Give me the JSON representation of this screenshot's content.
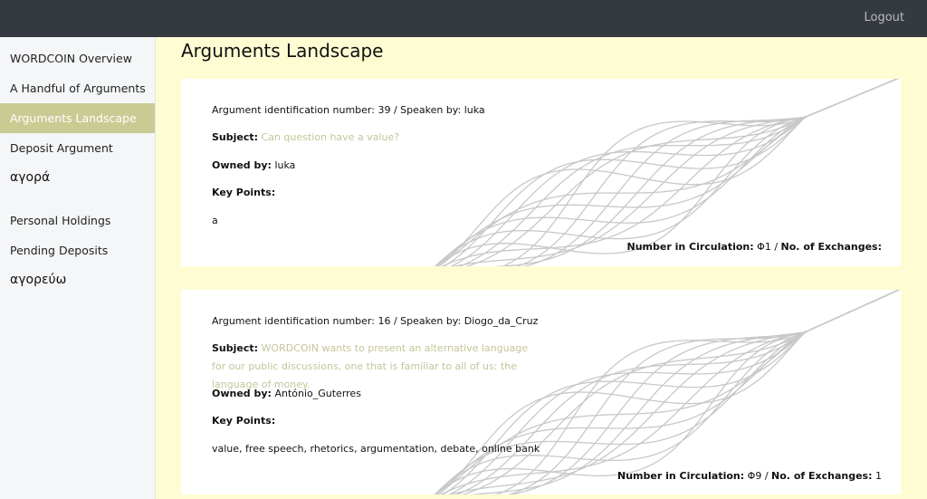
{
  "header": {
    "logout_label": "Logout"
  },
  "sidebar": {
    "items": [
      {
        "label": "WORDCOIN Overview"
      },
      {
        "label": "A Handful of Arguments"
      },
      {
        "label": "Arguments Landscape"
      },
      {
        "label": "Deposit Argument"
      },
      {
        "label": "αγορά"
      },
      {
        "label": "Personal Holdings"
      },
      {
        "label": "Pending Deposits"
      },
      {
        "label": "αγορεύω"
      }
    ]
  },
  "main": {
    "title": "Arguments Landscape",
    "cards": [
      {
        "id_line": "Argument identification number: 39 / Speaken by: luka",
        "subject_label": "Subject:",
        "subject_text": "Can question have a value?",
        "owned_label": "Owned by:",
        "owned_value": "luka",
        "keypoints_label": "Key Points:",
        "keypoints_value": "a",
        "circulation_label": "Number in Circulation:",
        "circulation_value": "Φ1",
        "separator": "/",
        "exchanges_label": "No. of Exchanges:",
        "exchanges_value": ""
      },
      {
        "id_line": "Argument identification number: 16 / Speaken by: Diogo_da_Cruz",
        "subject_label": "Subject:",
        "subject_text": "WORDCOIN wants to present an alternative language for our public discussions, one that is familiar to all of us: the language of money.",
        "owned_label": "Owned by:",
        "owned_value": "António_Guterres",
        "keypoints_label": "Key Points:",
        "keypoints_value": "value, free speech, rhetorics, argumentation, debate, online bank",
        "circulation_label": "Number in Circulation:",
        "circulation_value": "Φ9",
        "separator": "/",
        "exchanges_label": "No. of Exchanges:",
        "exchanges_value": "1"
      }
    ]
  },
  "colors": {
    "topbar": "#353a41",
    "sidebar_active": "#cacb93",
    "page_background": "#fefcd3",
    "subject_text": "#c5c49a",
    "wave_lines": "#c8c8c8"
  }
}
